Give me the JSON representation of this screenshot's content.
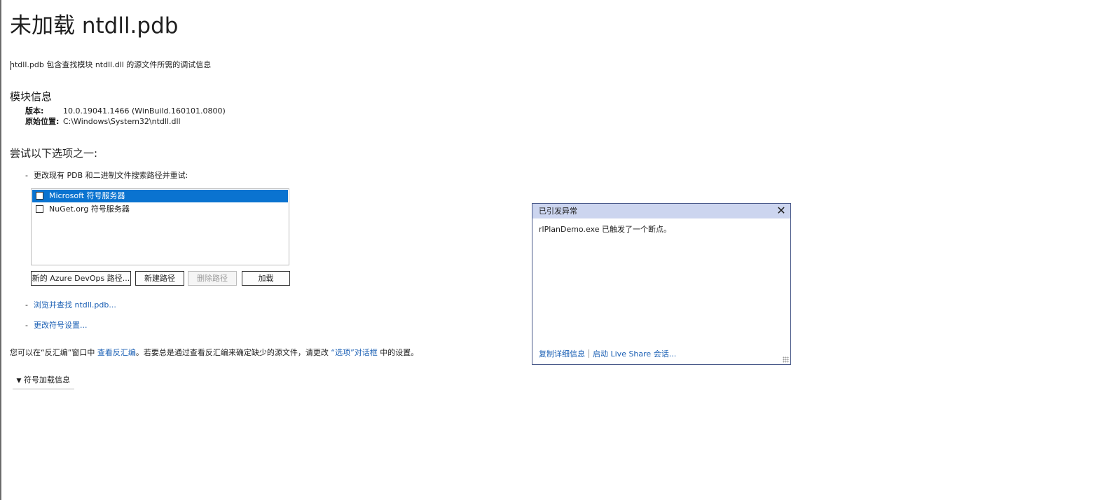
{
  "title": "未加载 ntdll.pdb",
  "description": "ntdll.pdb 包含查找模块 ntdll.dll 的源文件所需的调试信息",
  "module_info": {
    "heading": "模块信息",
    "rows": [
      {
        "key": "版本:",
        "value": "10.0.19041.1466 (WinBuild.160101.0800)"
      },
      {
        "key": "原始位置:",
        "value": "C:\\Windows\\System32\\ntdll.dll"
      }
    ]
  },
  "try_options": {
    "heading": "尝试以下选项之一:",
    "change_paths_label": "更改现有 PDB 和二进制文件搜索路径并重试:",
    "bullet": "-",
    "paths": [
      {
        "label": "Microsoft 符号服务器",
        "checked": false,
        "selected": true
      },
      {
        "label": "NuGet.org 符号服务器",
        "checked": false,
        "selected": false
      }
    ],
    "buttons": {
      "new_azure": "新的 Azure DevOps 路径...",
      "new_path": "新建路径",
      "delete_path": "删除路径",
      "load": "加载"
    },
    "browse_link": "浏览并查找 ntdll.pdb...",
    "symbol_settings_link": "更改符号设置..."
  },
  "bottom_note": {
    "part1": "您可以在“反汇编”窗口中 ",
    "link1": "查看反汇编",
    "part2": "。若要总是通过查看反汇编来确定缺少的源文件，请更改 ",
    "link2": "“选项”对话框",
    "part3": " 中的设置。"
  },
  "symbol_load_info": {
    "label": "符号加载信息",
    "icon": "chevron-down-icon"
  },
  "exception_popup": {
    "title": "已引发异常",
    "message": "rlPlanDemo.exe 已触发了一个断点。",
    "copy_details": "复制详细信息",
    "start_live_share": "启动 Live Share 会话...",
    "close_icon": "close-icon"
  },
  "colors": {
    "link": "#1a5fb4",
    "selection": "#0a73d0",
    "popup_header": "#ccd5ef",
    "popup_border": "#4a5a8a"
  }
}
